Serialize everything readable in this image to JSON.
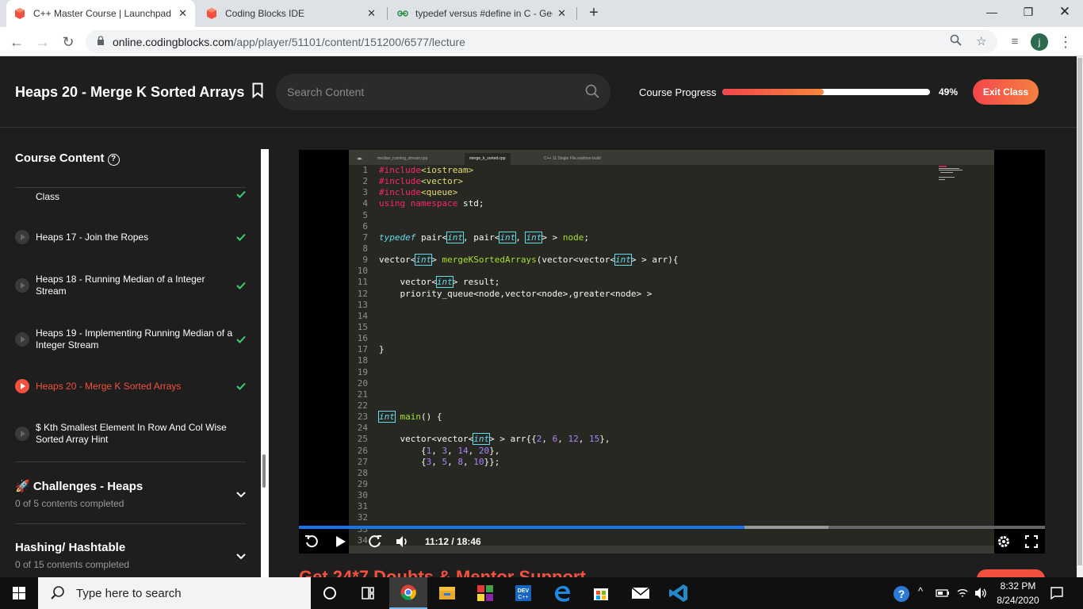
{
  "browser": {
    "tabs": [
      {
        "label": "C++ Master Course | Launchpad",
        "favicon": "codingblocks-icon",
        "active": true
      },
      {
        "label": "Coding Blocks IDE",
        "favicon": "codingblocks-icon",
        "active": false
      },
      {
        "label": "typedef versus #define in C - Gee",
        "favicon": "geeksforgeeks-icon",
        "active": false
      }
    ],
    "url_host": "online.codingblocks.com",
    "url_path": "/app/player/51101/content/151200/6577/lecture",
    "profile_initial": "j"
  },
  "header": {
    "lesson_title": "Heaps 20 - Merge K Sorted Arrays",
    "search_placeholder": "Search Content",
    "progress_label": "Course Progress",
    "progress_percent_text": "49%",
    "progress_fraction": 0.49,
    "exit_label": "Exit Class"
  },
  "sidebar": {
    "title": "Course Content",
    "lessons": [
      {
        "label": "Class",
        "done": true,
        "active": false
      },
      {
        "label": "Heaps 17 - Join the Ropes",
        "done": true,
        "active": false
      },
      {
        "label": "Heaps 18 - Running Median of a Integer Stream",
        "done": true,
        "active": false
      },
      {
        "label": "Heaps 19 - Implementing Running Median of a Integer Stream",
        "done": true,
        "active": false
      },
      {
        "label": "Heaps 20 - Merge K Sorted Arrays",
        "done": true,
        "active": true
      },
      {
        "label": "$ Kth Smallest Element In Row And Col Wise Sorted Array Hint",
        "done": false,
        "active": false
      }
    ],
    "sections": [
      {
        "title": "🚀 Challenges - Heaps",
        "subtitle": "0 of 5 contents completed"
      },
      {
        "title": "Hashing/ Hashtable",
        "subtitle": "0 of 15 contents completed"
      }
    ]
  },
  "video": {
    "time_text": "11:12 / 18:46",
    "played_fraction": 0.597,
    "buffered_fraction": 0.71,
    "editor_tabs": [
      "median_running_stream.cpp",
      "merge_k_sorted.cpp",
      "C++ 11 Single File.sublime-build"
    ],
    "code_lines": [
      "#include<iostream>",
      "#include<vector>",
      "#include<queue>",
      "using namespace std;",
      "",
      "",
      "typedef pair<int, pair<int, int> > node;",
      "",
      "vector<int> mergeKSortedArrays(vector<vector<int> > arr){",
      "",
      "    vector<int> result;",
      "    priority_queue<node,vector<node>,greater<node> >",
      "",
      "",
      "",
      "",
      "}",
      "",
      "",
      "",
      "",
      "",
      "int main() {",
      "",
      "    vector<vector<int> > arr{{2, 6, 12, 15},",
      "        {1, 3, 14, 20},",
      "        {3, 5, 8, 10}};",
      "",
      "",
      "",
      "",
      "",
      "",
      ""
    ]
  },
  "promo_text": "Get 24*7 Doubts & Mentor Support",
  "taskbar": {
    "search_placeholder": "Type here to search",
    "time": "8:32 PM",
    "date": "8/24/2020"
  }
}
